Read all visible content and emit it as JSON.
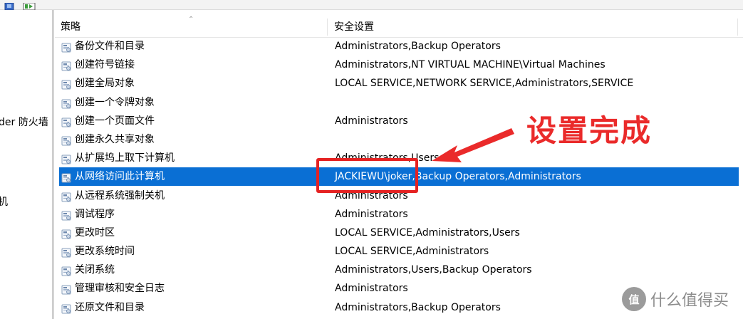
{
  "tree": {
    "item1": "der 防火墙",
    "item2": "机"
  },
  "list": {
    "headers": {
      "policy": "策略",
      "setting": "安全设置"
    },
    "rows": [
      {
        "name": "备份文件和目录",
        "value": "Administrators,Backup Operators",
        "selected": false
      },
      {
        "name": "创建符号链接",
        "value": "Administrators,NT VIRTUAL MACHINE\\Virtual Machines",
        "selected": false
      },
      {
        "name": "创建全局对象",
        "value": "LOCAL SERVICE,NETWORK SERVICE,Administrators,SERVICE",
        "selected": false
      },
      {
        "name": "创建一个令牌对象",
        "value": "",
        "selected": false
      },
      {
        "name": "创建一个页面文件",
        "value": "Administrators",
        "selected": false
      },
      {
        "name": "创建永久共享对象",
        "value": "",
        "selected": false
      },
      {
        "name": "从扩展坞上取下计算机",
        "value": "Administrators,Users",
        "selected": false
      },
      {
        "name": "从网络访问此计算机",
        "value": "JACKIEWU\\joker,Backup Operators,Administrators",
        "selected": true
      },
      {
        "name": "从远程系统强制关机",
        "value": "Administrators",
        "selected": false
      },
      {
        "name": "调试程序",
        "value": "Administrators",
        "selected": false
      },
      {
        "name": "更改时区",
        "value": "LOCAL SERVICE,Administrators,Users",
        "selected": false
      },
      {
        "name": "更改系统时间",
        "value": "LOCAL SERVICE,Administrators",
        "selected": false
      },
      {
        "name": "关闭系统",
        "value": "Administrators,Users,Backup Operators",
        "selected": false
      },
      {
        "name": "管理审核和安全日志",
        "value": "Administrators",
        "selected": false
      },
      {
        "name": "还原文件和目录",
        "value": "Administrators,Backup Operators",
        "selected": false
      }
    ]
  },
  "annotation": {
    "callout_text": "设置完成",
    "color": "#e52222"
  },
  "watermark": {
    "badge": "值",
    "text": "什么值得买"
  },
  "colors": {
    "selection": "#0a6fd4"
  }
}
